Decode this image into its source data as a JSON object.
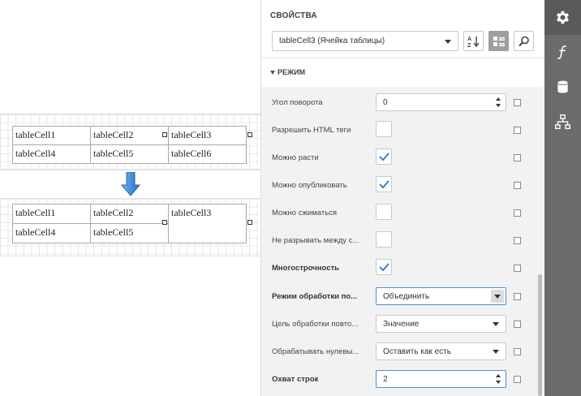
{
  "designer": {
    "table_before": {
      "rows": [
        [
          "tableCell1",
          "tableCell2",
          "tableCell3"
        ],
        [
          "tableCell4",
          "tableCell5",
          "tableCell6"
        ]
      ]
    },
    "table_after": {
      "row1": [
        "tableCell1",
        "tableCell2",
        "tableCell3"
      ],
      "row2": [
        "tableCell4",
        "tableCell5"
      ]
    }
  },
  "panel": {
    "title": "СВОЙСТВА",
    "component_selector": "tableCell3 (Ячейка таблицы)",
    "section": "РЕЖИМ",
    "properties": {
      "rotation": {
        "label": "Угол поворота",
        "value": "0"
      },
      "allow_html": {
        "label": "Разрешить HTML теги",
        "checked": false
      },
      "can_grow": {
        "label": "Можно расти",
        "checked": true
      },
      "can_publish": {
        "label": "Можно опубликовать",
        "checked": true
      },
      "can_shrink": {
        "label": "Можно сжиматься",
        "checked": false
      },
      "keep_together": {
        "label": "Не разрывать между с...",
        "checked": false
      },
      "multiline": {
        "label": "Многострочность",
        "checked": true
      },
      "process_duplicates_mode": {
        "label": "Режим обработки по...",
        "value": "Объединить"
      },
      "process_duplicates_target": {
        "label": "Цель обработки повто...",
        "value": "Значение"
      },
      "process_null_values": {
        "label": "Обрабатывать нулевы...",
        "value": "Оставить как есть"
      },
      "row_span": {
        "label": "Охват строк",
        "value": "2"
      }
    }
  },
  "rail": {
    "items": [
      "gear-icon",
      "function-icon",
      "database-icon",
      "hierarchy-icon"
    ]
  },
  "colors": {
    "rail": "#6b6b6b",
    "arrow": "#3a86d4",
    "props_bg": "#f2f2f2",
    "focus": "#4a90d9"
  }
}
